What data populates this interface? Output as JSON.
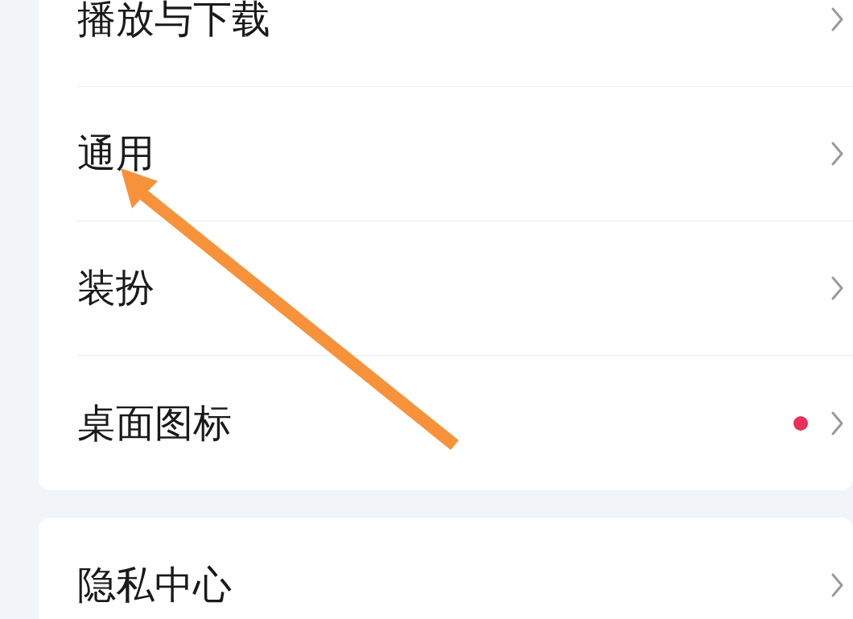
{
  "groups": [
    {
      "items": [
        {
          "label": "播放与下载",
          "badge": false
        },
        {
          "label": "通用",
          "badge": false
        },
        {
          "label": "装扮",
          "badge": false
        },
        {
          "label": "桌面图标",
          "badge": true
        }
      ]
    },
    {
      "items": [
        {
          "label": "隐私中心",
          "badge": false
        }
      ]
    }
  ]
}
